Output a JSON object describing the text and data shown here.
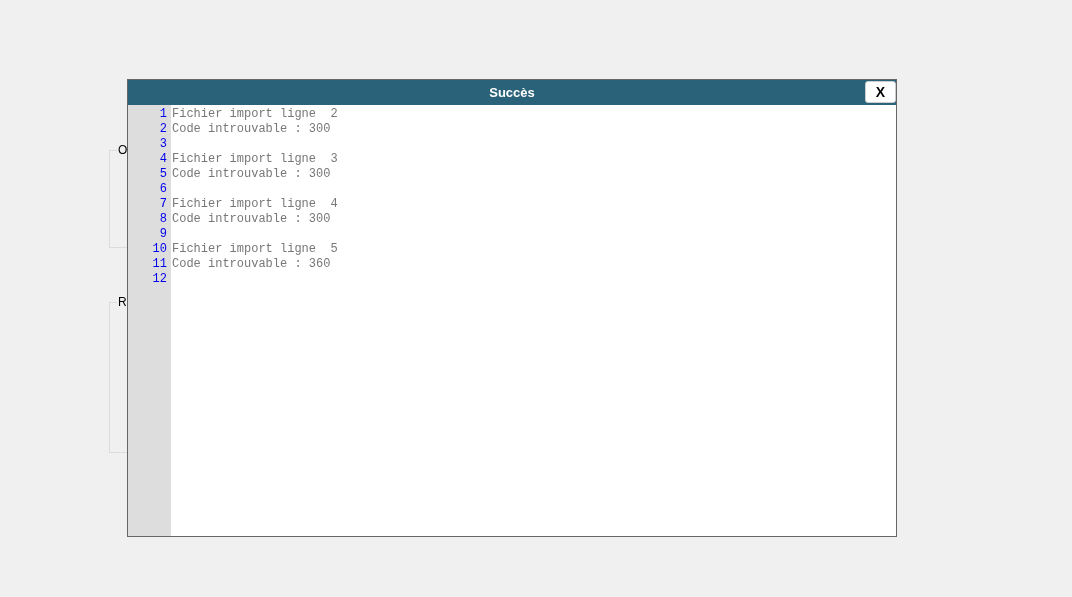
{
  "background_groups": [
    {
      "legend": "O"
    },
    {
      "legend": "R"
    }
  ],
  "dialog": {
    "title": "Succès",
    "close_button": "X",
    "lines": [
      {
        "number": "1",
        "text": "Fichier import ligne  2"
      },
      {
        "number": "2",
        "text": "Code introuvable : 300"
      },
      {
        "number": "3"
      },
      {
        "number": "4",
        "text": "Fichier import ligne  3"
      },
      {
        "number": "5",
        "text": "Code introuvable : 300"
      },
      {
        "number": "6"
      },
      {
        "number": "7",
        "text": "Fichier import ligne  4"
      },
      {
        "number": "8",
        "text": "Code introuvable : 300"
      },
      {
        "number": "9"
      },
      {
        "number": "10",
        "text": "Fichier import ligne  5"
      },
      {
        "number": "11",
        "text": "Code introuvable : 360"
      },
      {
        "number": "12"
      }
    ]
  }
}
